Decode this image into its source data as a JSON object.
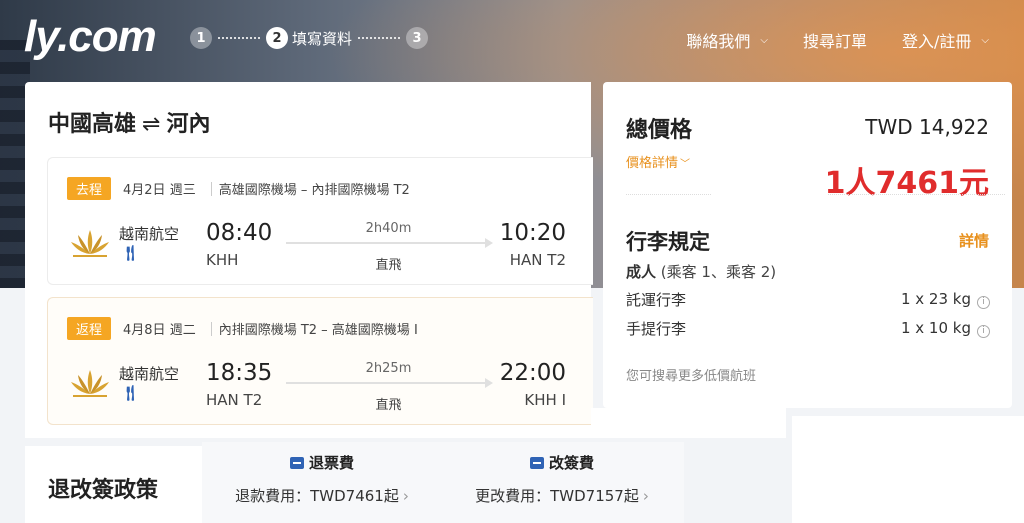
{
  "brand": {
    "logo": "ly.com"
  },
  "steps": [
    {
      "num": "1",
      "label": ""
    },
    {
      "num": "2",
      "label": "填寫資料"
    },
    {
      "num": "3",
      "label": ""
    }
  ],
  "nav": {
    "contact": "聯絡我們",
    "search_orders": "搜尋訂單",
    "login": "登入/註冊"
  },
  "route": {
    "from": "中國高雄",
    "swap": "⇌",
    "to": "河內"
  },
  "legs": [
    {
      "tag": "去程",
      "date": "4月2日 週三",
      "airports": "高雄國際機場 – 內排國際機場 T2",
      "airline": "越南航空",
      "dep_time": "08:40",
      "dep_code": "KHH",
      "duration": "2h40m",
      "type": "直飛",
      "arr_time": "10:20",
      "arr_code": "HAN T2"
    },
    {
      "tag": "返程",
      "date": "4月8日 週二",
      "airports": "內排國際機場 T2 – 高雄國際機場 I",
      "airline": "越南航空",
      "dep_time": "18:35",
      "dep_code": "HAN T2",
      "duration": "2h25m",
      "type": "直飛",
      "arr_time": "22:00",
      "arr_code": "KHH I"
    }
  ],
  "price": {
    "total_label": "總價格",
    "total_value": "TWD 14,922",
    "detail_link": "價格詳情",
    "per_person": "1人7461元"
  },
  "baggage": {
    "title": "行李規定",
    "detail": "詳情",
    "passenger_type": "成人",
    "passengers": "(乘客 1、乘客 2)",
    "checked_label": "託運行李",
    "checked_value": "1 x 23 kg",
    "carry_label": "手提行李",
    "carry_value": "1 x 10 kg",
    "more": "您可搜尋更多低價航班"
  },
  "policy": {
    "title": "退改簽政策",
    "refund_head": "退票費",
    "refund_value": "退款費用：TWD7461起",
    "change_head": "改簽費",
    "change_value": "更改費用：TWD7157起"
  },
  "colors": {
    "accent": "#e8911e",
    "price_red": "#e02c2c",
    "tag_orange": "#f5a623",
    "icon_blue": "#2f63b5"
  }
}
